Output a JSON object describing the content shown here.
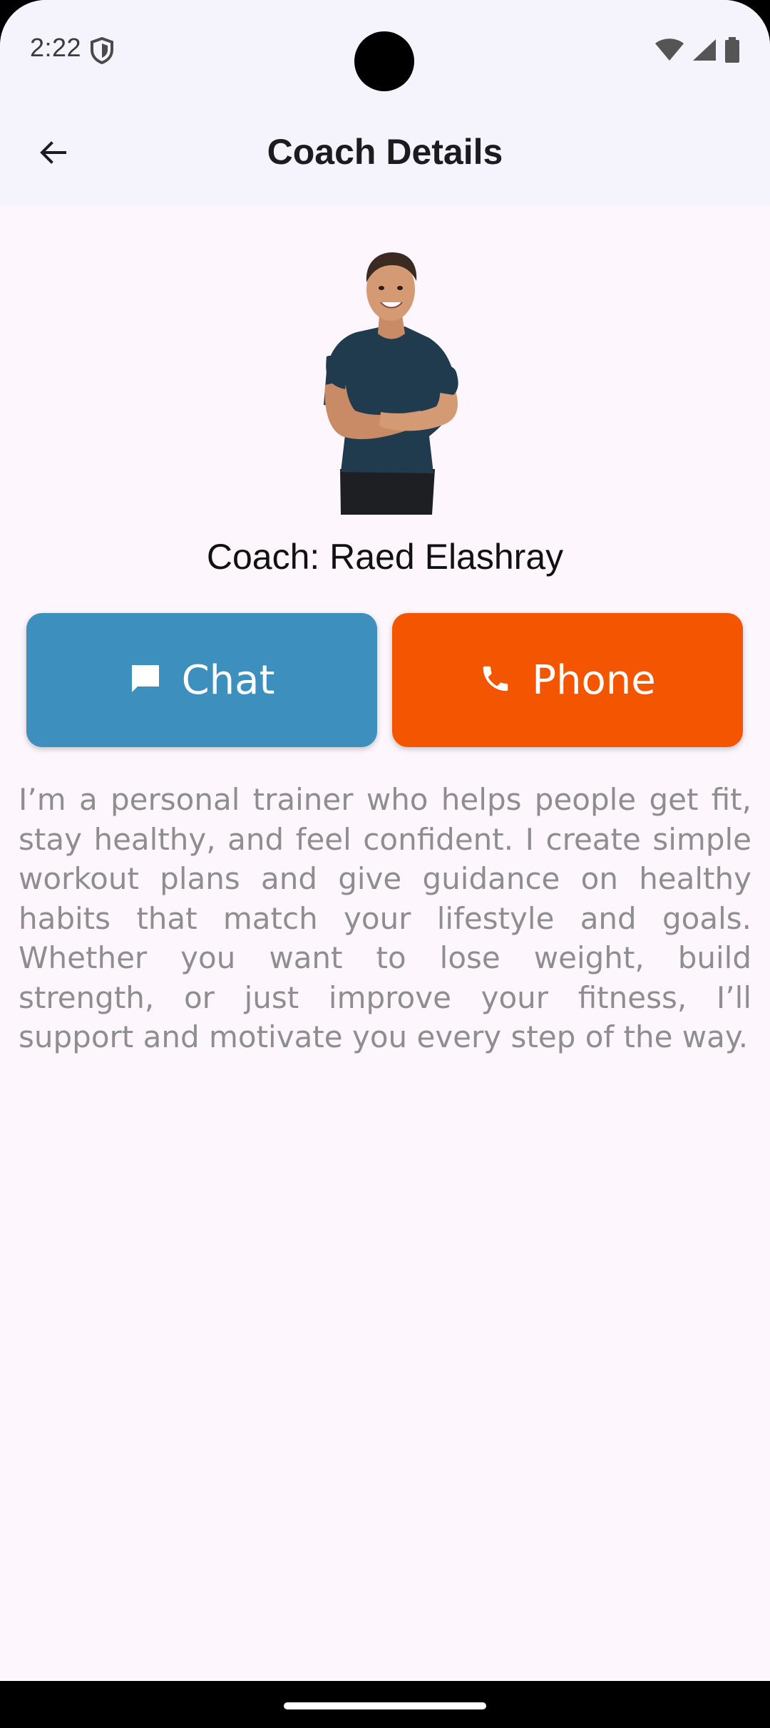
{
  "status_bar": {
    "time": "2:22",
    "icons": [
      "shield-icon",
      "wifi-icon",
      "signal-icon",
      "battery-icon"
    ]
  },
  "app_bar": {
    "title": "Coach Details",
    "back_icon": "arrow-back-icon"
  },
  "coach": {
    "name_label": "Coach: Raed Elashray",
    "photo": "coach-photo"
  },
  "actions": {
    "chat": {
      "label": "Chat",
      "icon": "chat-bubble-icon",
      "color": "#3d8fbe"
    },
    "phone": {
      "label": "Phone",
      "icon": "phone-icon",
      "color": "#f45500"
    }
  },
  "bio": "I’m a personal trainer who helps people get fit, stay healthy, and feel confident. I create simple workout plans and give guidance on healthy habits that match your lifestyle and goals. Whether you want to lose weight, build strength, or just improve your fitness, I’ll support and motivate you every step of the way.",
  "colors": {
    "background": "#fdf7fd",
    "app_bar": "#f5f3fb",
    "text_primary": "#1c1b1f",
    "text_secondary": "#8e8e8e"
  }
}
